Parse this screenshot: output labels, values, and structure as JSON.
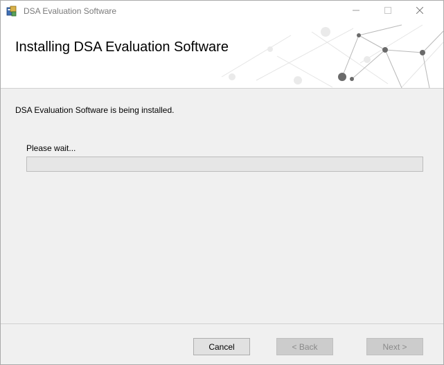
{
  "window": {
    "title": "DSA Evaluation Software",
    "icons": {
      "app": "installer-icon",
      "minimize": "minimize-icon",
      "maximize": "maximize-icon",
      "close": "close-icon"
    }
  },
  "header": {
    "title": "Installing DSA Evaluation Software",
    "decoration": "network-graph-art"
  },
  "body": {
    "status": "DSA Evaluation Software is being installed.",
    "wait_label": "Please wait...",
    "progress_fraction": 0
  },
  "footer": {
    "cancel_label": "Cancel",
    "back_label": "< Back",
    "next_label": "Next >"
  },
  "colors": {
    "header_bg": "#ffffff",
    "body_bg": "#f0f0f0",
    "progress_track": "#e6e6e6",
    "disabled_text": "#8a8a8a"
  }
}
